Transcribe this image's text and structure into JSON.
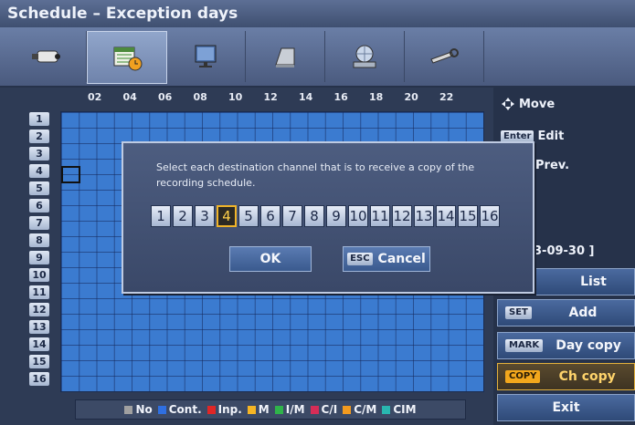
{
  "title": "Schedule – Exception days",
  "tabs": [
    {
      "icon": "camera-icon"
    },
    {
      "icon": "calendar-clock-icon",
      "active": true
    },
    {
      "icon": "monitor-icon"
    },
    {
      "icon": "hard-disk-icon"
    },
    {
      "icon": "network-icon"
    },
    {
      "icon": "tools-icon"
    }
  ],
  "hours": [
    "02",
    "04",
    "06",
    "08",
    "10",
    "12",
    "14",
    "16",
    "18",
    "20",
    "22"
  ],
  "channels": [
    "1",
    "2",
    "3",
    "4",
    "5",
    "6",
    "7",
    "8",
    "9",
    "10",
    "11",
    "12",
    "13",
    "14",
    "15",
    "16"
  ],
  "legend": [
    {
      "label": "No",
      "color": "#a0a0a0"
    },
    {
      "label": "Cont.",
      "color": "#2f6fe0"
    },
    {
      "label": "Inp.",
      "color": "#e02626"
    },
    {
      "label": "M",
      "color": "#f5b524"
    },
    {
      "label": "I/M",
      "color": "#2fb34a"
    },
    {
      "label": "C/I",
      "color": "#d62d57"
    },
    {
      "label": "C/M",
      "color": "#f29a1f"
    },
    {
      "label": "CIM",
      "color": "#29b7b0"
    }
  ],
  "side": {
    "move": "Move",
    "enter_key": "Enter",
    "edit": "Edit",
    "prev": "Prev.",
    "date": "3-09-30 ]",
    "list": "List",
    "set_key": "SET",
    "add": "Add",
    "mark_key": "MARK",
    "day_copy": "Day copy",
    "copy_key": "COPY",
    "ch_copy": "Ch copy",
    "exit": "Exit"
  },
  "dialog": {
    "message": "Select each destination channel that is to receive a copy of the recording schedule.",
    "channels": [
      "1",
      "2",
      "3",
      "4",
      "5",
      "6",
      "7",
      "8",
      "9",
      "10",
      "11",
      "12",
      "13",
      "14",
      "15",
      "16"
    ],
    "selected_channel": "4",
    "ok": "OK",
    "esc_key": "ESC",
    "cancel": "Cancel"
  },
  "colors": {
    "grid": "#3b7bd0",
    "accent": "#f0b429"
  }
}
